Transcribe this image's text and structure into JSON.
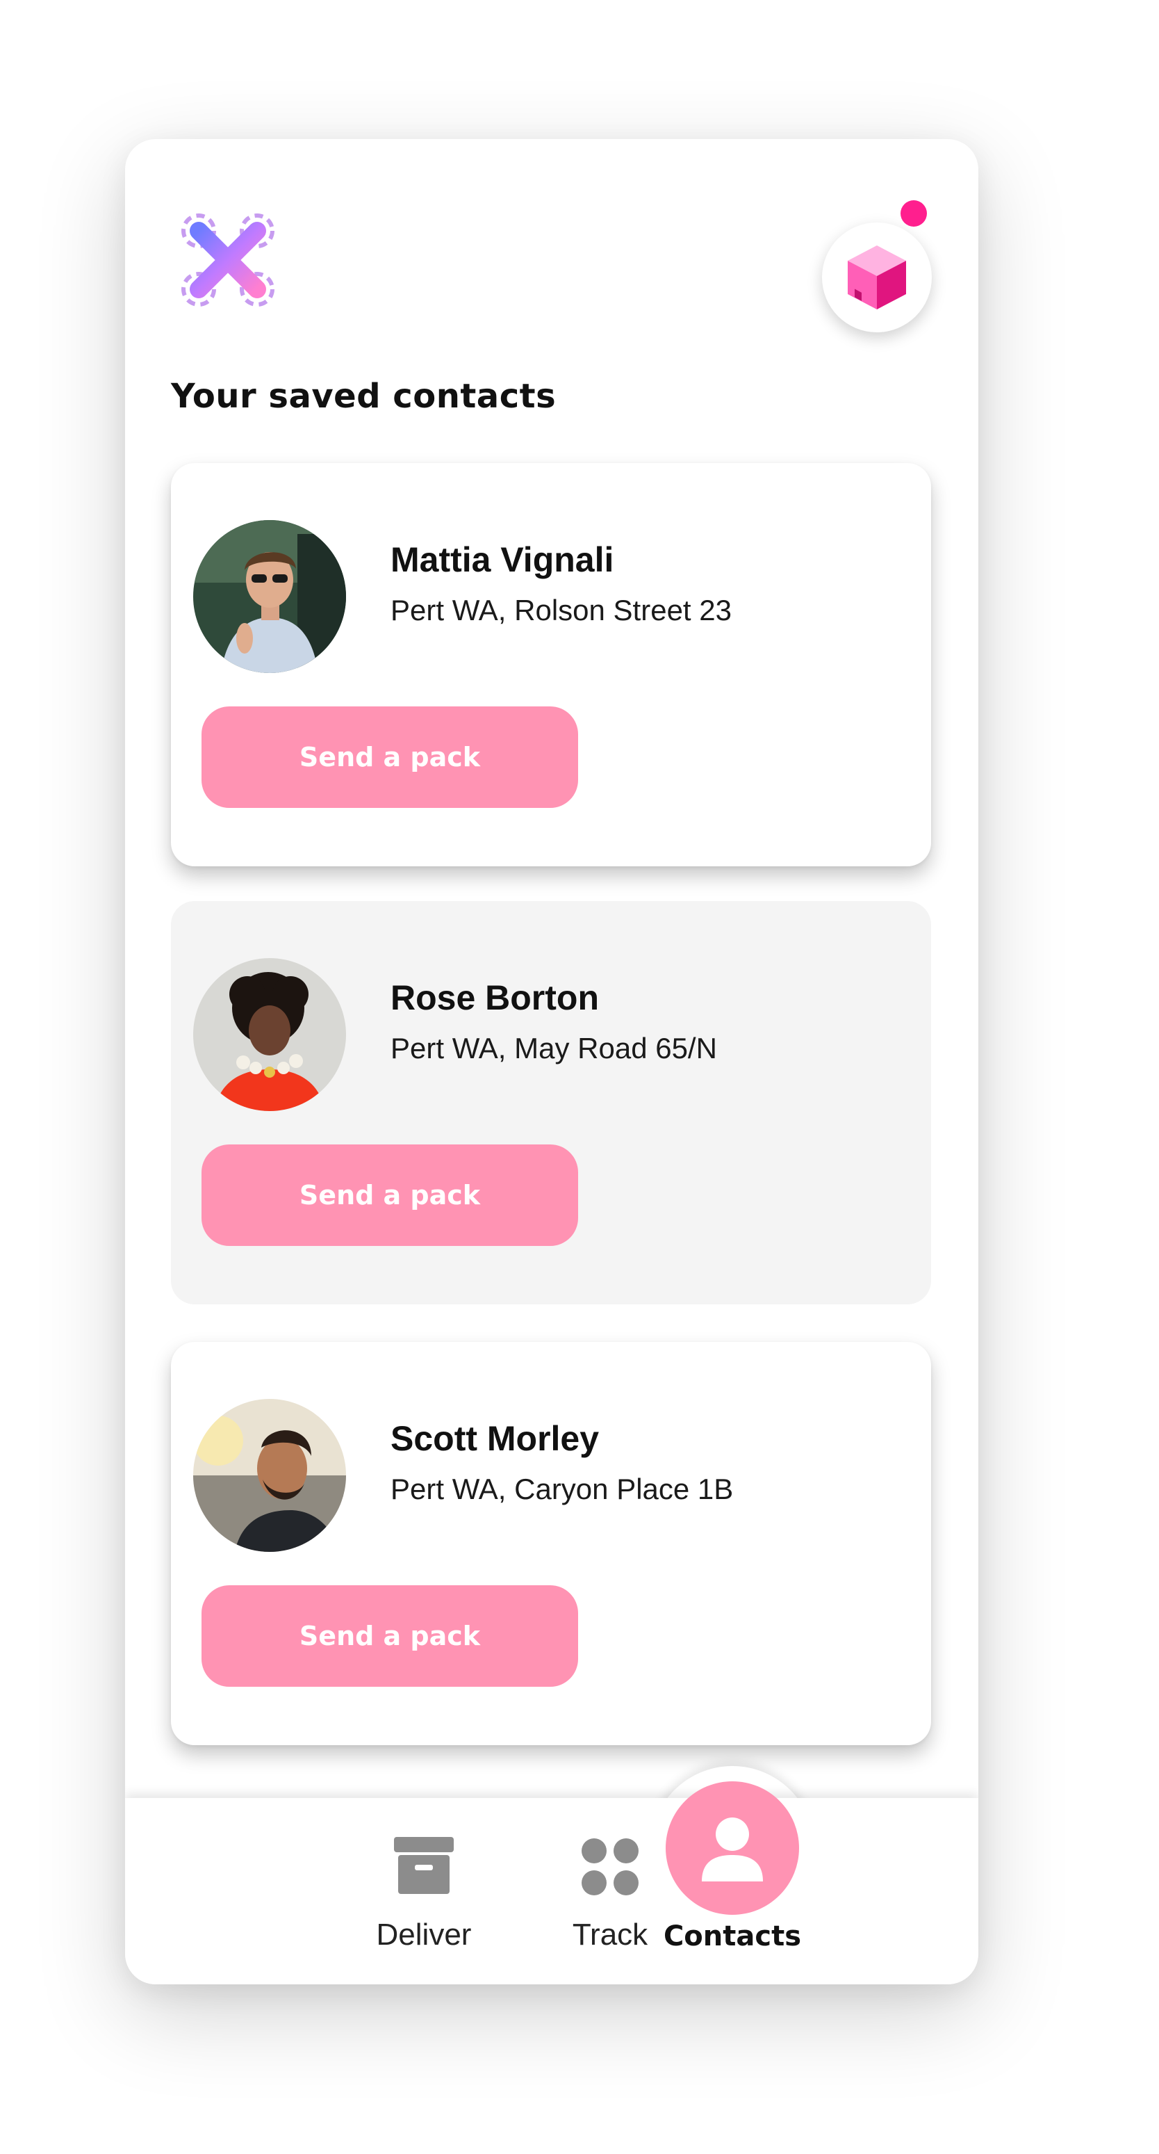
{
  "header": {
    "logo_icon": "drone-logo-icon",
    "pack_icon": "package-cube-icon",
    "has_notification": true
  },
  "page": {
    "title": "Your saved contacts"
  },
  "contacts": [
    {
      "name": "Mattia Vignali",
      "address": "Pert WA, Rolson Street 23",
      "action_label": "Send a pack"
    },
    {
      "name": "Rose Borton",
      "address": "Pert WA, May Road 65/N",
      "action_label": "Send a pack"
    },
    {
      "name": "Scott Morley",
      "address": "Pert WA, Caryon Place 1B",
      "action_label": "Send a pack"
    }
  ],
  "nav": {
    "items": [
      {
        "label": "Deliver",
        "icon": "archive-box-icon",
        "active": false
      },
      {
        "label": "Track",
        "icon": "four-dots-grid-icon",
        "active": false
      },
      {
        "label": "Contacts",
        "icon": "user-icon",
        "active": true
      }
    ]
  },
  "colors": {
    "accent": "#ff93b3",
    "notification": "#ff1f8e",
    "muted_card": "#f4f4f4"
  }
}
